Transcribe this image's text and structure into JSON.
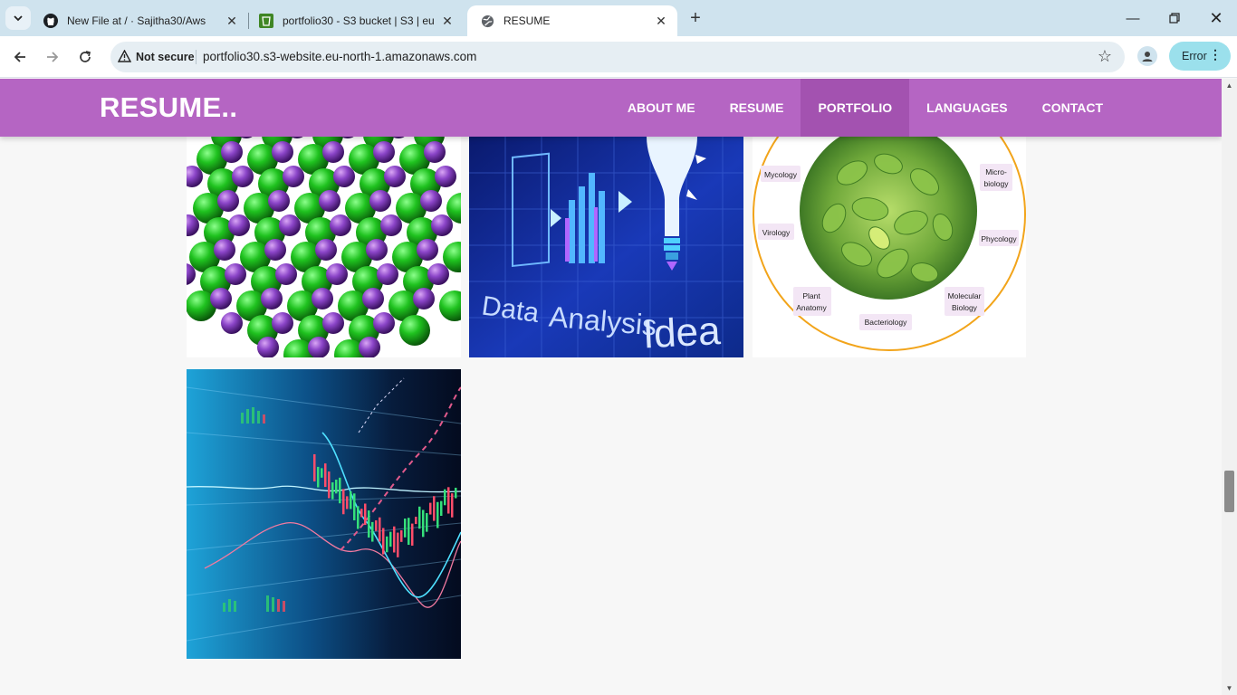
{
  "browser": {
    "tabs": [
      {
        "title": "New File at / · Sajitha30/Aws",
        "icon": "github-icon"
      },
      {
        "title": "portfolio30 - S3 bucket | S3 | eu",
        "icon": "aws-s3-icon"
      },
      {
        "title": "RESUME",
        "icon": "globe-icon"
      }
    ],
    "security_label": "Not secure",
    "url": "portfolio30.s3-website.eu-north-1.amazonaws.com",
    "error_label": "Error"
  },
  "site": {
    "brand": "RESUME..",
    "menu": [
      {
        "label": "ABOUT ME"
      },
      {
        "label": "RESUME"
      },
      {
        "label": "PORTFOLIO",
        "active": true
      },
      {
        "label": "LANGUAGES"
      },
      {
        "label": "CONTACT"
      }
    ]
  },
  "gallery": {
    "data_analysis_words": [
      "Data",
      "Analysis",
      "Idea"
    ],
    "botany_topics": {
      "mycology": "Mycology",
      "microbiology_line1": "Micro-",
      "microbiology_line2": "biology",
      "virology": "Virology",
      "phycology": "Phycology",
      "plant_anatomy_line1": "Plant",
      "plant_anatomy_line2": "Anatomy",
      "molecular_biology_line1": "Molecular",
      "molecular_biology_line2": "Biology",
      "bacteriology": "Bacteriology"
    }
  },
  "colors": {
    "nav_bg": "#b565c3",
    "nav_active": "#a352b0"
  }
}
